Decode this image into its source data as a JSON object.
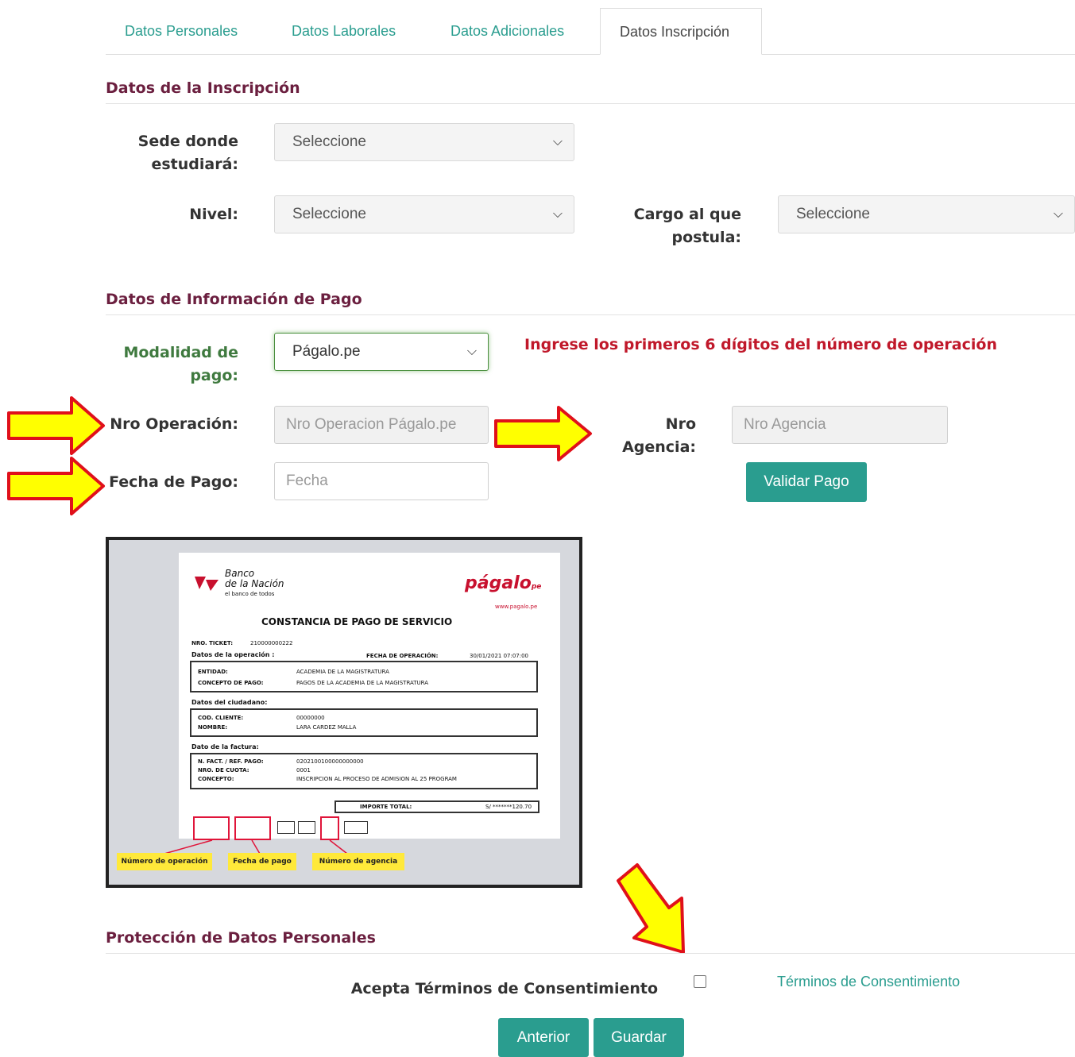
{
  "tabs": [
    {
      "label": "Datos Personales"
    },
    {
      "label": "Datos Laborales"
    },
    {
      "label": "Datos Adicionales"
    },
    {
      "label": "Datos Inscripción"
    }
  ],
  "inscripcion": {
    "title": "Datos de la Inscripción",
    "sede_label": "Sede donde estudiará:",
    "sede_value": "Seleccione",
    "nivel_label": "Nivel:",
    "nivel_value": "Seleccione",
    "cargo_label": "Cargo al que postula:",
    "cargo_value": "Seleccione"
  },
  "pago": {
    "title": "Datos de Información de Pago",
    "modalidad_label": "Modalidad de pago:",
    "modalidad_value": "Págalo.pe",
    "warning": "Ingrese los primeros 6 dígitos del número de operación",
    "nro_operacion_label": "Nro Operación:",
    "nro_operacion_placeholder": "Nro Operacion Págalo.pe",
    "nro_agencia_label": "Nro Agencia:",
    "nro_agencia_placeholder": "Nro Agencia",
    "fecha_label": "Fecha de Pago:",
    "fecha_placeholder": "Fecha",
    "validar_label": "Validar Pago"
  },
  "receipt": {
    "bank_line1": "Banco",
    "bank_line2": "de la Nación",
    "bank_tag": "el banco de todos",
    "brand": "págalo",
    "brand_suffix": "pe",
    "brand_url": "www.pagalo.pe",
    "title": "CONSTANCIA DE PAGO DE SERVICIO",
    "ticket_label": "NRO. TICKET:",
    "ticket_value": "210000000222",
    "op_section": "Datos de la operación :",
    "fecha_op_label": "FECHA DE OPERACIÓN:",
    "fecha_op_value": "30/01/2021 07:07:00",
    "entidad_label": "ENTIDAD:",
    "entidad_value": "ACADEMIA DE LA MAGISTRATURA",
    "concepto_pago_label": "CONCEPTO DE PAGO:",
    "concepto_pago_value": "PAGOS DE LA ACADEMIA DE LA MAGISTRATURA",
    "ciudadano_section": "Datos del ciudadano:",
    "cod_cliente_label": "COD. CLIENTE:",
    "cod_cliente_value": "00000000",
    "nombre_label": "NOMBRE:",
    "nombre_value": "LARA CARDEZ MALLA",
    "factura_section": "Dato de la factura:",
    "nfact_label": "N. FACT. / REF. PAGO:",
    "nfact_value": "0202100100000000000",
    "cuota_label": "NRO. DE CUOTA:",
    "cuota_value": "0001",
    "concepto_label": "CONCEPTO:",
    "concepto_value": "INSCRIPCION AL PROCESO DE ADMISION AL 25 PROGRAM",
    "importe_label": "IMPORTE TOTAL:",
    "importe_value": "S/ *******120.70",
    "hl_operacion": "Número de operación",
    "hl_fecha": "Fecha de pago",
    "hl_agencia": "Número de agencia"
  },
  "proteccion": {
    "title": "Protección de Datos Personales",
    "acepta_label": "Acepta Términos de Consentimiento",
    "terminos_link": "Términos de Consentimiento"
  },
  "footer": {
    "anterior_label": "Anterior",
    "guardar_label": "Guardar"
  },
  "colors": {
    "accent": "#2a9d8f",
    "heading": "#6b1f3f",
    "warning": "#c0182a",
    "arrow_fill": "#ffff00",
    "arrow_stroke": "#e0101a"
  }
}
